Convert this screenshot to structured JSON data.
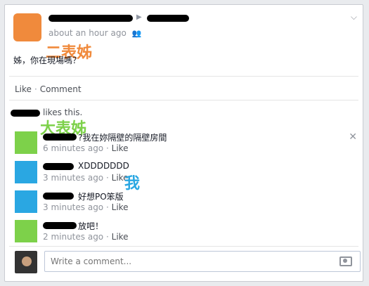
{
  "post": {
    "time": "about an hour ago",
    "text": "姊，你在現場嗎？",
    "annotation": "二表姊"
  },
  "actions": {
    "like": "Like",
    "dot": "·",
    "comment": "Comment"
  },
  "likes": {
    "text": "likes this."
  },
  "comments": [
    {
      "text": "?我在妳隔壁的隔壁房間",
      "time": "6 minutes ago",
      "like": "Like",
      "annotation": "大表姊"
    },
    {
      "text": "XDDDDDDD",
      "time": "3 minutes ago",
      "like": "Like",
      "annotation": "我"
    },
    {
      "text": "好想PO笨版",
      "time": "3 minutes ago",
      "like": "Like"
    },
    {
      "text": "放吧！",
      "time": "2 minutes ago",
      "like": "Like"
    }
  ],
  "composer": {
    "placeholder": "Write a comment..."
  },
  "colors": {
    "orange": "#f08a3c",
    "green": "#7dd14a",
    "blue": "#2aa7e2"
  },
  "icons": {
    "friends": "friends-icon",
    "chevron": "chevron-down-icon",
    "close": "close-icon",
    "camera": "camera-icon"
  }
}
